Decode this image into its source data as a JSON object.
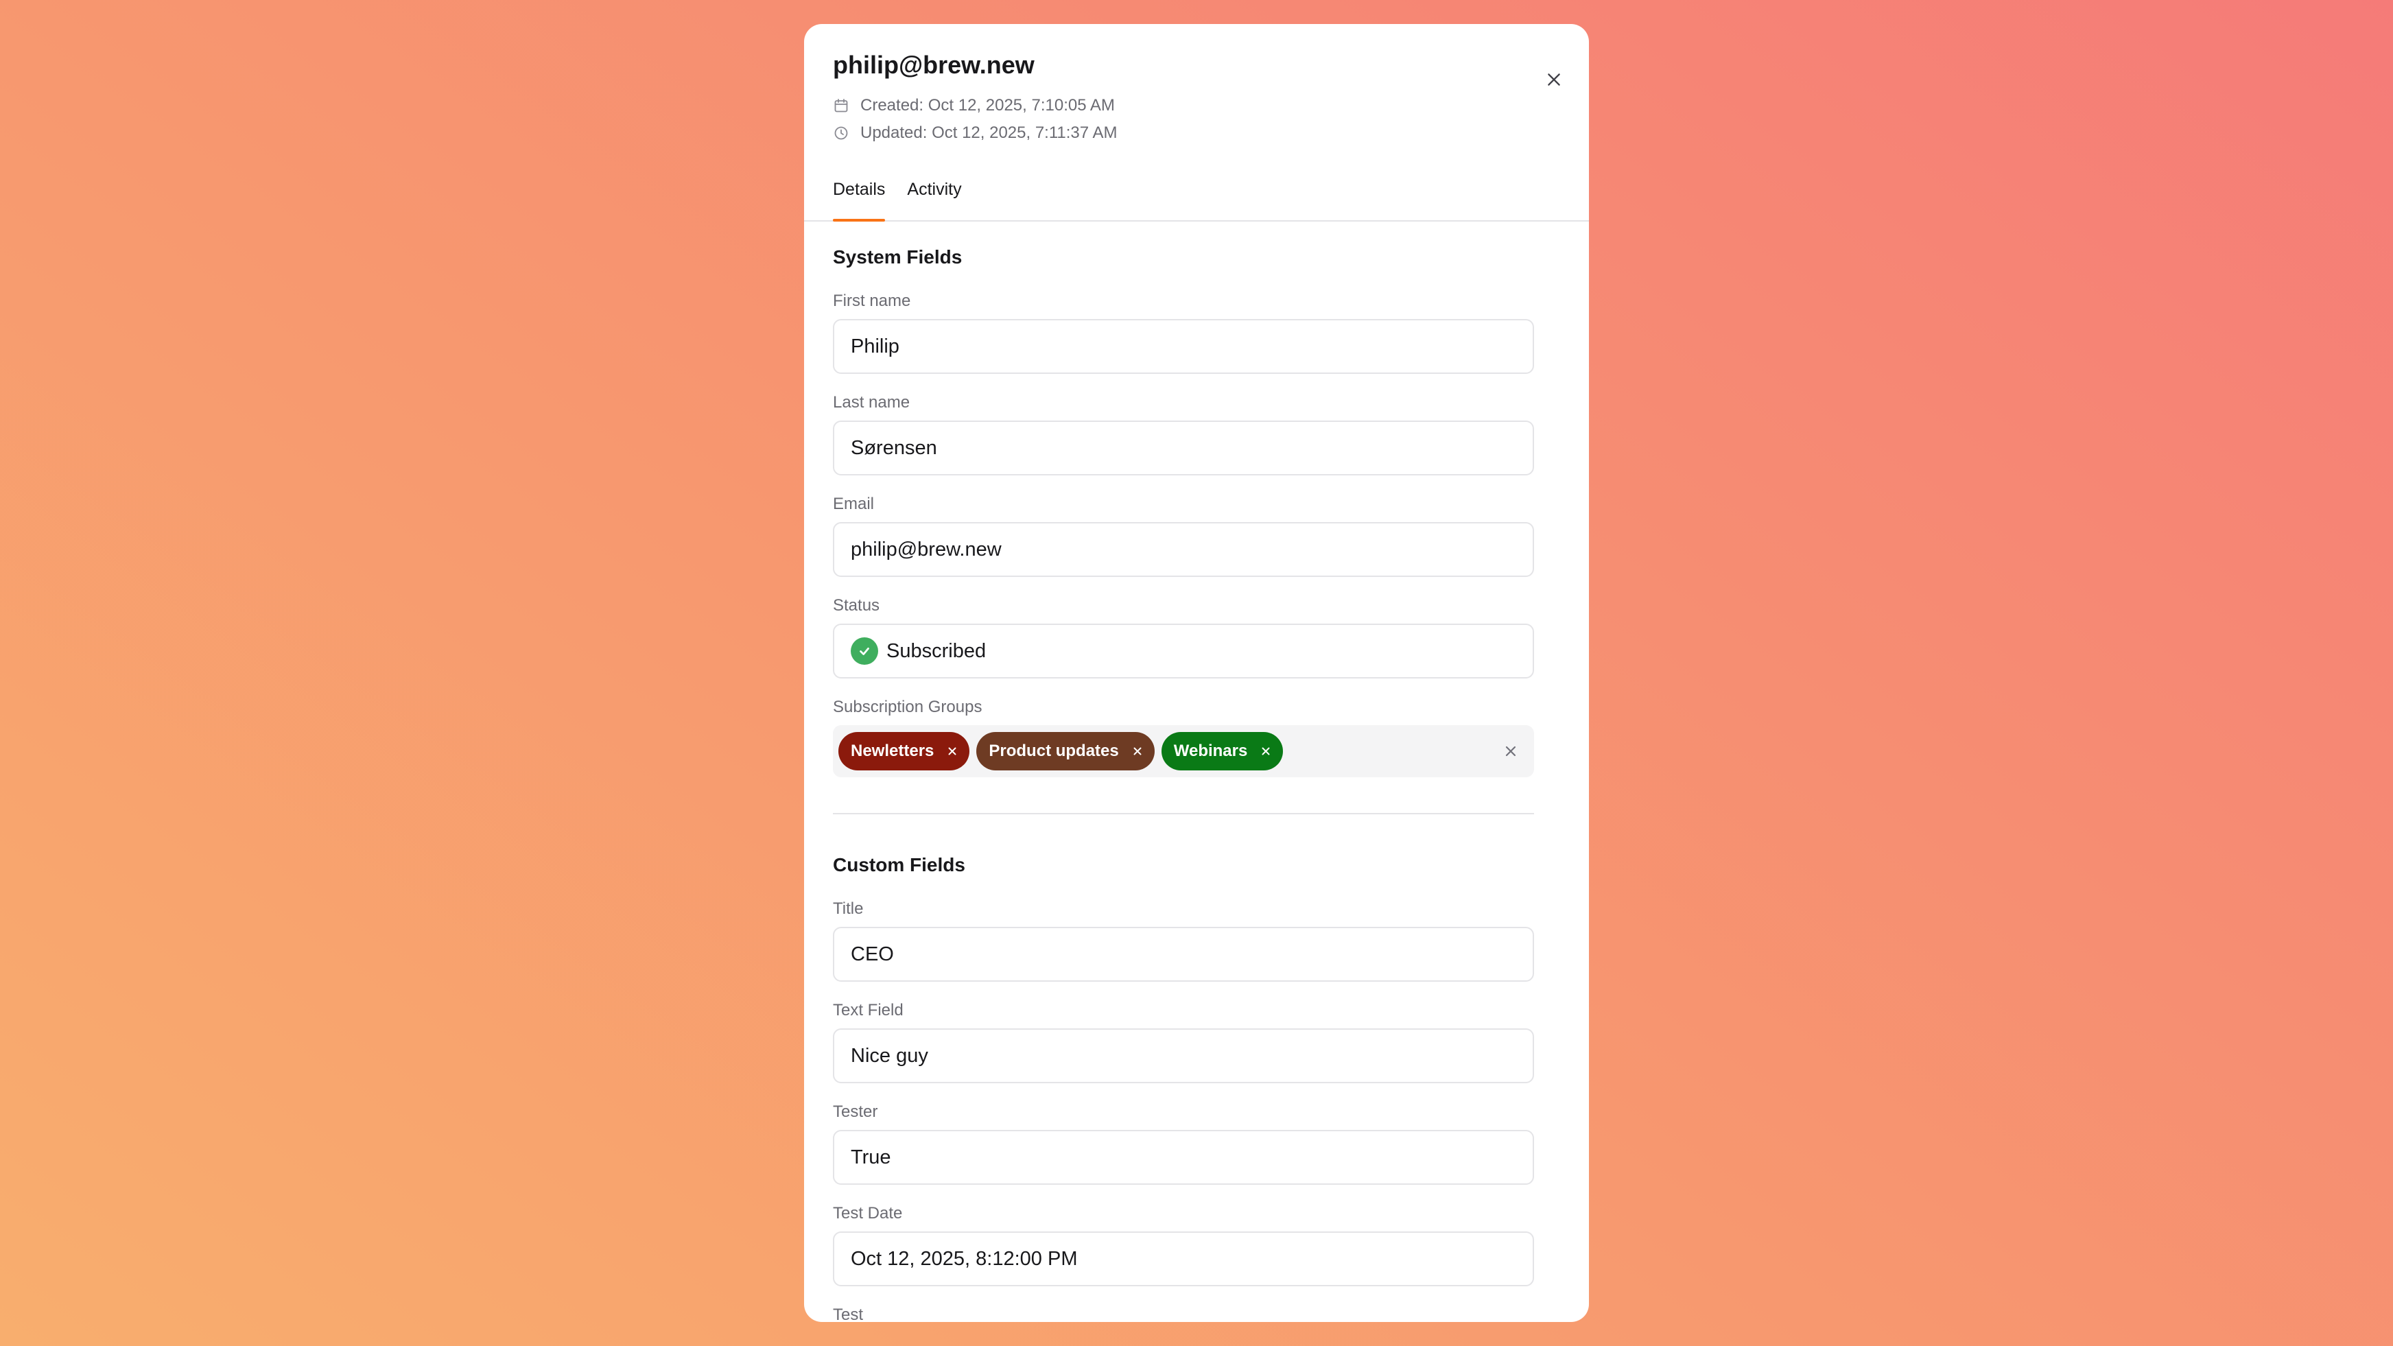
{
  "contact": {
    "title": "philip@brew.new",
    "created": "Created: Oct 12, 2025, 7:10:05 AM",
    "updated": "Updated: Oct 12, 2025, 7:11:37 AM"
  },
  "tabs": [
    {
      "label": "Details",
      "active": true
    },
    {
      "label": "Activity",
      "active": false
    }
  ],
  "system_fields": {
    "heading": "System Fields",
    "first_name": {
      "label": "First name",
      "value": "Philip"
    },
    "last_name": {
      "label": "Last name",
      "value": "Sørensen"
    },
    "email": {
      "label": "Email",
      "value": "philip@brew.new"
    },
    "status": {
      "label": "Status",
      "value": "Subscribed",
      "color": "#3fae5e"
    },
    "groups": {
      "label": "Subscription Groups",
      "tags": [
        {
          "label": "Newletters",
          "color": "#8b1a0c"
        },
        {
          "label": "Product updates",
          "color": "#6e3b23"
        },
        {
          "label": "Webinars",
          "color": "#0a7a16"
        }
      ]
    }
  },
  "custom_fields": {
    "heading": "Custom Fields",
    "title": {
      "label": "Title",
      "value": "CEO"
    },
    "text_field": {
      "label": "Text Field",
      "value": "Nice guy"
    },
    "tester": {
      "label": "Tester",
      "value": "True"
    },
    "test_date": {
      "label": "Test Date",
      "value": "Oct 12, 2025, 8:12:00 PM"
    },
    "test": {
      "label": "Test"
    }
  },
  "icons": {
    "close": "close-icon",
    "created": "calendar-icon",
    "updated": "clock-icon",
    "status": "check-circle-icon",
    "tag_remove": "x-icon",
    "clear_all": "x-icon"
  },
  "colors": {
    "accent": "#f97316"
  }
}
